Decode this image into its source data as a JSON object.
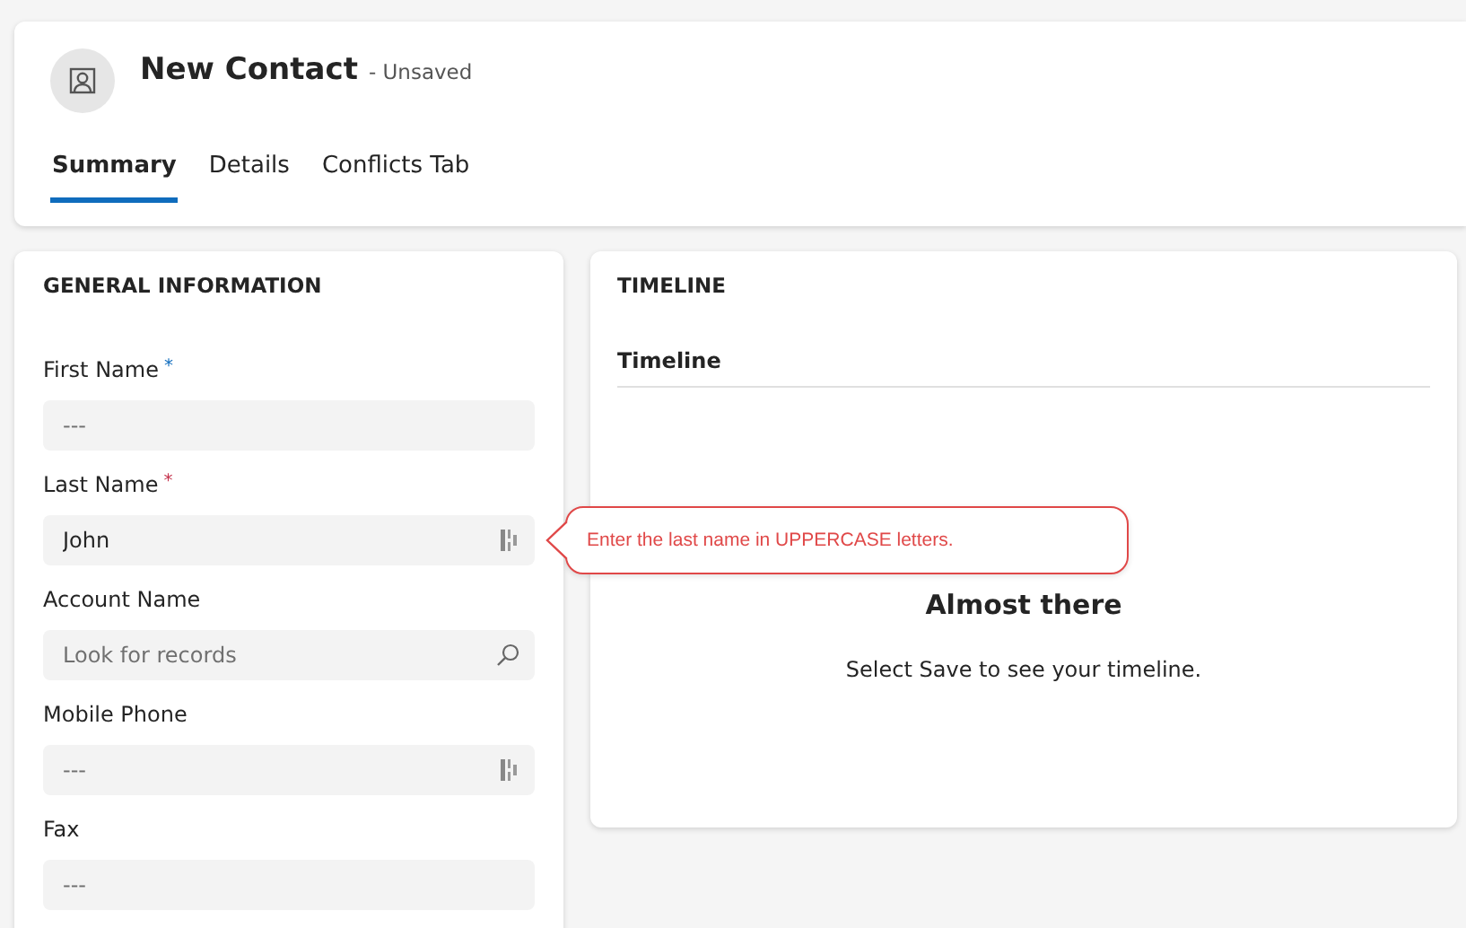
{
  "header": {
    "title": "New Contact",
    "status": "- Unsaved"
  },
  "tabs": [
    {
      "label": "Summary",
      "selected": true
    },
    {
      "label": "Details",
      "selected": false
    },
    {
      "label": "Conflicts Tab",
      "selected": false
    }
  ],
  "general": {
    "title": "GENERAL INFORMATION",
    "fields": [
      {
        "label": "First Name",
        "marker": {
          "text": "*",
          "color": "#0f6cbd"
        },
        "kind": "text",
        "placeholder": "---"
      },
      {
        "label": "Last Name",
        "marker": {
          "text": "*",
          "color": "#c4314b"
        },
        "kind": "text-with-icon",
        "value": "John",
        "error": "Enter the last name in UPPERCASE letters."
      },
      {
        "label": "Account Name",
        "kind": "lookup",
        "placeholder": "Look for records"
      },
      {
        "label": "Mobile Phone",
        "kind": "text-with-icon",
        "placeholder": "---"
      },
      {
        "label": "Fax",
        "kind": "text",
        "placeholder": "---"
      }
    ]
  },
  "timeline": {
    "title": "TIMELINE",
    "subtitle": "Timeline",
    "empty_title": "Almost there",
    "empty_text": "Select Save to see your timeline."
  }
}
